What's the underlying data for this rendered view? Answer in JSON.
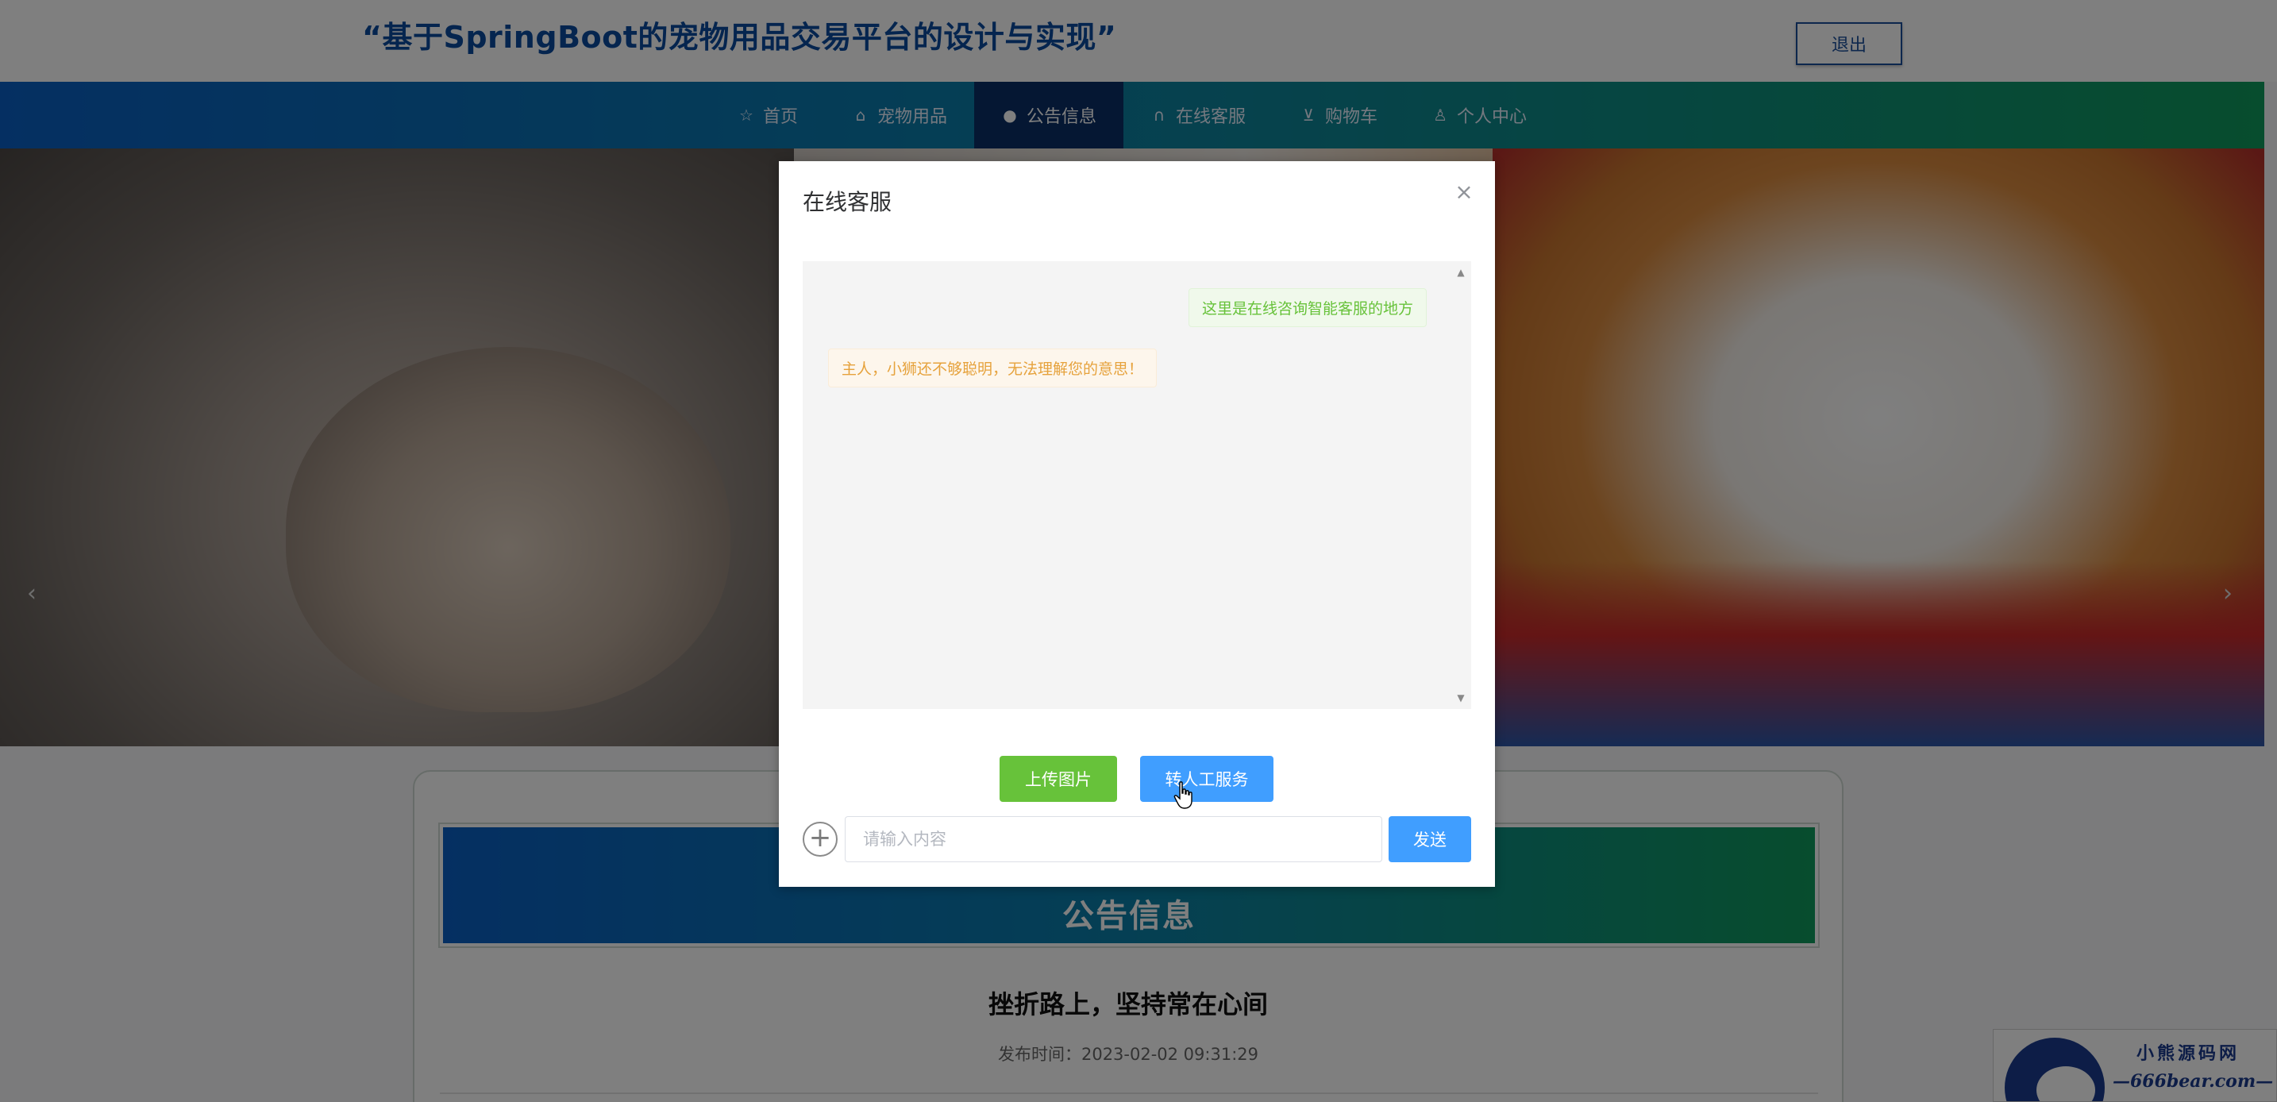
{
  "header": {
    "site_title": "“基于SpringBoot的宠物用品交易平台的设计与实现”",
    "logout_label": "退出"
  },
  "nav": {
    "items": [
      {
        "label": "首页",
        "icon": "star-icon"
      },
      {
        "label": "宠物用品",
        "icon": "bag-icon"
      },
      {
        "label": "公告信息",
        "icon": "info-icon"
      },
      {
        "label": "在线客服",
        "icon": "headset-icon"
      },
      {
        "label": "购物车",
        "icon": "cart-icon"
      },
      {
        "label": "个人中心",
        "icon": "user-icon"
      }
    ],
    "active": "公告信息"
  },
  "banner": {
    "prev_icon": "chevron-left-icon",
    "next_icon": "chevron-right-icon"
  },
  "notice": {
    "heading": "公告信息",
    "article_title": "挫折路上，坚持常在心间",
    "publish_time": "发布时间：2023-02-02 09:31:29"
  },
  "dialog": {
    "title": "在线客服",
    "messages": {
      "user": "这里是在线咨询智能客服的地方",
      "bot": "主人，小狮还不够聪明，无法理解您的意思！"
    },
    "upload_label": "上传图片",
    "transfer_label": "转人工服务",
    "input_placeholder": "请输入内容",
    "input_value": "",
    "send_label": "发送"
  },
  "watermark": {
    "line1": "小熊源码网",
    "line2": "—666bear.com—"
  },
  "colors": {
    "brand_blue": "#0a5fc4",
    "brand_green": "#0f9a5c",
    "nav_active": "#0a2f66",
    "button_green": "#67c23a",
    "button_blue": "#409eff"
  }
}
